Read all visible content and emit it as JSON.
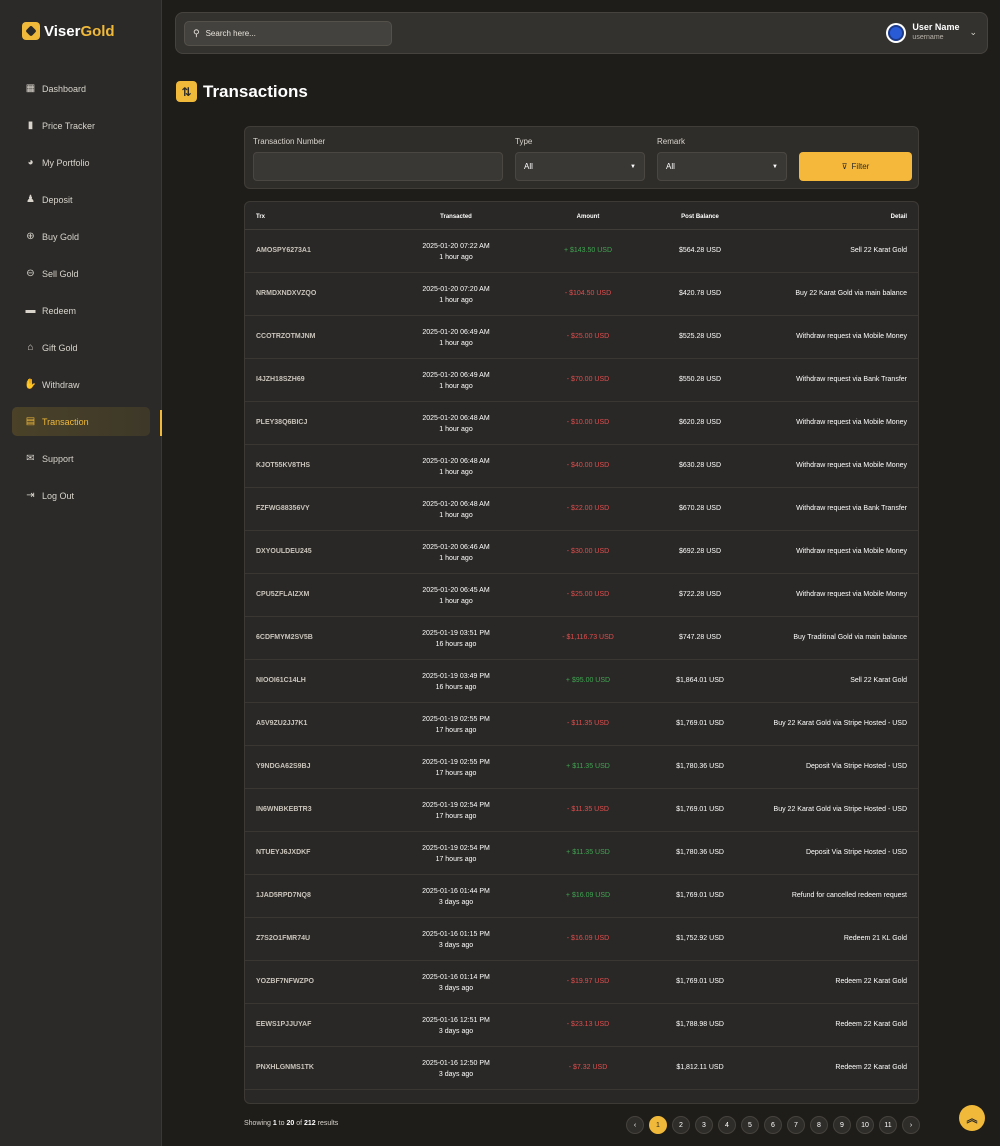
{
  "brand": {
    "part1": "Viser",
    "part2": "Gold"
  },
  "sidebar": {
    "items": [
      {
        "label": "Dashboard",
        "icon": "grid-icon",
        "glyph": "▦"
      },
      {
        "label": "Price Tracker",
        "icon": "bar-chart-icon",
        "glyph": "▮"
      },
      {
        "label": "My Portfolio",
        "icon": "pie-chart-icon",
        "glyph": "◕"
      },
      {
        "label": "Deposit",
        "icon": "money-bag-icon",
        "glyph": "♟"
      },
      {
        "label": "Buy Gold",
        "icon": "buy-gold-icon",
        "glyph": "⊕"
      },
      {
        "label": "Sell Gold",
        "icon": "sell-gold-icon",
        "glyph": "⊖"
      },
      {
        "label": "Redeem",
        "icon": "truck-icon",
        "glyph": "▬"
      },
      {
        "label": "Gift Gold",
        "icon": "gift-icon",
        "glyph": "⌂"
      },
      {
        "label": "Withdraw",
        "icon": "hand-money-icon",
        "glyph": "✋"
      },
      {
        "label": "Transaction",
        "icon": "receipt-icon",
        "glyph": "▤",
        "active": true
      },
      {
        "label": "Support",
        "icon": "envelope-icon",
        "glyph": "✉"
      },
      {
        "label": "Log Out",
        "icon": "logout-icon",
        "glyph": "⇥"
      }
    ]
  },
  "header": {
    "search_placeholder": "Search here...",
    "user_name": "User Name",
    "user_handle": "username"
  },
  "page": {
    "title": "Transactions"
  },
  "filter": {
    "trx_label": "Transaction Number",
    "trx_value": "",
    "type_label": "Type",
    "type_value": "All",
    "remark_label": "Remark",
    "remark_value": "All",
    "button_label": "Filter"
  },
  "table": {
    "headers": [
      "Trx",
      "Transacted",
      "Amount",
      "Post Balance",
      "Detail"
    ],
    "rows": [
      {
        "trx": "AMOSPY6273A1",
        "date": "2025-01-20 07:22 AM",
        "ago": "1 hour ago",
        "amount": "+ $143.50 USD",
        "sign": "plus",
        "balance": "$564.28 USD",
        "detail": "Sell 22 Karat Gold"
      },
      {
        "trx": "NRMDXNDXVZQO",
        "date": "2025-01-20 07:20 AM",
        "ago": "1 hour ago",
        "amount": "- $104.50 USD",
        "sign": "minus",
        "balance": "$420.78 USD",
        "detail": "Buy 22 Karat Gold via main balance"
      },
      {
        "trx": "CCOTRZOTMJNM",
        "date": "2025-01-20 06:49 AM",
        "ago": "1 hour ago",
        "amount": "- $25.00 USD",
        "sign": "minus",
        "balance": "$525.28 USD",
        "detail": "Withdraw request via Mobile Money"
      },
      {
        "trx": "I4JZH18SZH69",
        "date": "2025-01-20 06:49 AM",
        "ago": "1 hour ago",
        "amount": "- $70.00 USD",
        "sign": "minus",
        "balance": "$550.28 USD",
        "detail": "Withdraw request via Bank Transfer"
      },
      {
        "trx": "PLEY38Q6BICJ",
        "date": "2025-01-20 06:48 AM",
        "ago": "1 hour ago",
        "amount": "- $10.00 USD",
        "sign": "minus",
        "balance": "$620.28 USD",
        "detail": "Withdraw request via Mobile Money"
      },
      {
        "trx": "KJOT55KV8THS",
        "date": "2025-01-20 06:48 AM",
        "ago": "1 hour ago",
        "amount": "- $40.00 USD",
        "sign": "minus",
        "balance": "$630.28 USD",
        "detail": "Withdraw request via Mobile Money"
      },
      {
        "trx": "FZFWG88356VY",
        "date": "2025-01-20 06:48 AM",
        "ago": "1 hour ago",
        "amount": "- $22.00 USD",
        "sign": "minus",
        "balance": "$670.28 USD",
        "detail": "Withdraw request via Bank Transfer"
      },
      {
        "trx": "DXYOULDEU245",
        "date": "2025-01-20 06:46 AM",
        "ago": "1 hour ago",
        "amount": "- $30.00 USD",
        "sign": "minus",
        "balance": "$692.28 USD",
        "detail": "Withdraw request via Mobile Money"
      },
      {
        "trx": "CPU5ZFLAIZXM",
        "date": "2025-01-20 06:45 AM",
        "ago": "1 hour ago",
        "amount": "- $25.00 USD",
        "sign": "minus",
        "balance": "$722.28 USD",
        "detail": "Withdraw request via Mobile Money"
      },
      {
        "trx": "6CDFMYM2SV5B",
        "date": "2025-01-19 03:51 PM",
        "ago": "16 hours ago",
        "amount": "- $1,116.73 USD",
        "sign": "minus",
        "balance": "$747.28 USD",
        "detail": "Buy Traditinal Gold via main balance"
      },
      {
        "trx": "NIOOI61C14LH",
        "date": "2025-01-19 03:49 PM",
        "ago": "16 hours ago",
        "amount": "+ $95.00 USD",
        "sign": "plus",
        "balance": "$1,864.01 USD",
        "detail": "Sell 22 Karat Gold"
      },
      {
        "trx": "A5V9ZU2JJ7K1",
        "date": "2025-01-19 02:55 PM",
        "ago": "17 hours ago",
        "amount": "- $11.35 USD",
        "sign": "minus",
        "balance": "$1,769.01 USD",
        "detail": "Buy 22 Karat Gold via Stripe Hosted - USD"
      },
      {
        "trx": "Y9NDGA62S9BJ",
        "date": "2025-01-19 02:55 PM",
        "ago": "17 hours ago",
        "amount": "+ $11.35 USD",
        "sign": "plus",
        "balance": "$1,780.36 USD",
        "detail": "Deposit Via Stripe Hosted - USD"
      },
      {
        "trx": "IN6WNBKEBTR3",
        "date": "2025-01-19 02:54 PM",
        "ago": "17 hours ago",
        "amount": "- $11.35 USD",
        "sign": "minus",
        "balance": "$1,769.01 USD",
        "detail": "Buy 22 Karat Gold via Stripe Hosted - USD"
      },
      {
        "trx": "NTUEYJ6JXDKF",
        "date": "2025-01-19 02:54 PM",
        "ago": "17 hours ago",
        "amount": "+ $11.35 USD",
        "sign": "plus",
        "balance": "$1,780.36 USD",
        "detail": "Deposit Via Stripe Hosted - USD"
      },
      {
        "trx": "1JAD5RPD7NQ8",
        "date": "2025-01-16 01:44 PM",
        "ago": "3 days ago",
        "amount": "+ $16.09 USD",
        "sign": "plus",
        "balance": "$1,769.01 USD",
        "detail": "Refund for cancelled redeem request"
      },
      {
        "trx": "Z7S2O1FMR74U",
        "date": "2025-01-16 01:15 PM",
        "ago": "3 days ago",
        "amount": "- $16.09 USD",
        "sign": "minus",
        "balance": "$1,752.92 USD",
        "detail": "Redeem 21 KL Gold"
      },
      {
        "trx": "YOZBF7NFWZPO",
        "date": "2025-01-16 01:14 PM",
        "ago": "3 days ago",
        "amount": "- $19.97 USD",
        "sign": "minus",
        "balance": "$1,769.01 USD",
        "detail": "Redeem 22 Karat Gold"
      },
      {
        "trx": "EEWS1PJJUYAF",
        "date": "2025-01-16 12:51 PM",
        "ago": "3 days ago",
        "amount": "- $23.13 USD",
        "sign": "minus",
        "balance": "$1,788.98 USD",
        "detail": "Redeem 22 Karat Gold"
      },
      {
        "trx": "PNXHLGNMS1TK",
        "date": "2025-01-16 12:50 PM",
        "ago": "3 days ago",
        "amount": "- $7.32 USD",
        "sign": "minus",
        "balance": "$1,812.11 USD",
        "detail": "Redeem 22 Karat Gold"
      }
    ]
  },
  "footer": {
    "showing_prefix": "Showing",
    "from": "1",
    "to_word": "to",
    "to": "20",
    "of_word": "of",
    "total": "212",
    "suffix": "results"
  },
  "pagination": {
    "prev": "‹",
    "next": "›",
    "pages": [
      "1",
      "2",
      "3",
      "4",
      "5",
      "6",
      "7",
      "8",
      "9",
      "10",
      "11"
    ],
    "current": "1"
  },
  "colors": {
    "accent": "#f0b93a",
    "positive": "#3fa552",
    "negative": "#e14d4d"
  }
}
